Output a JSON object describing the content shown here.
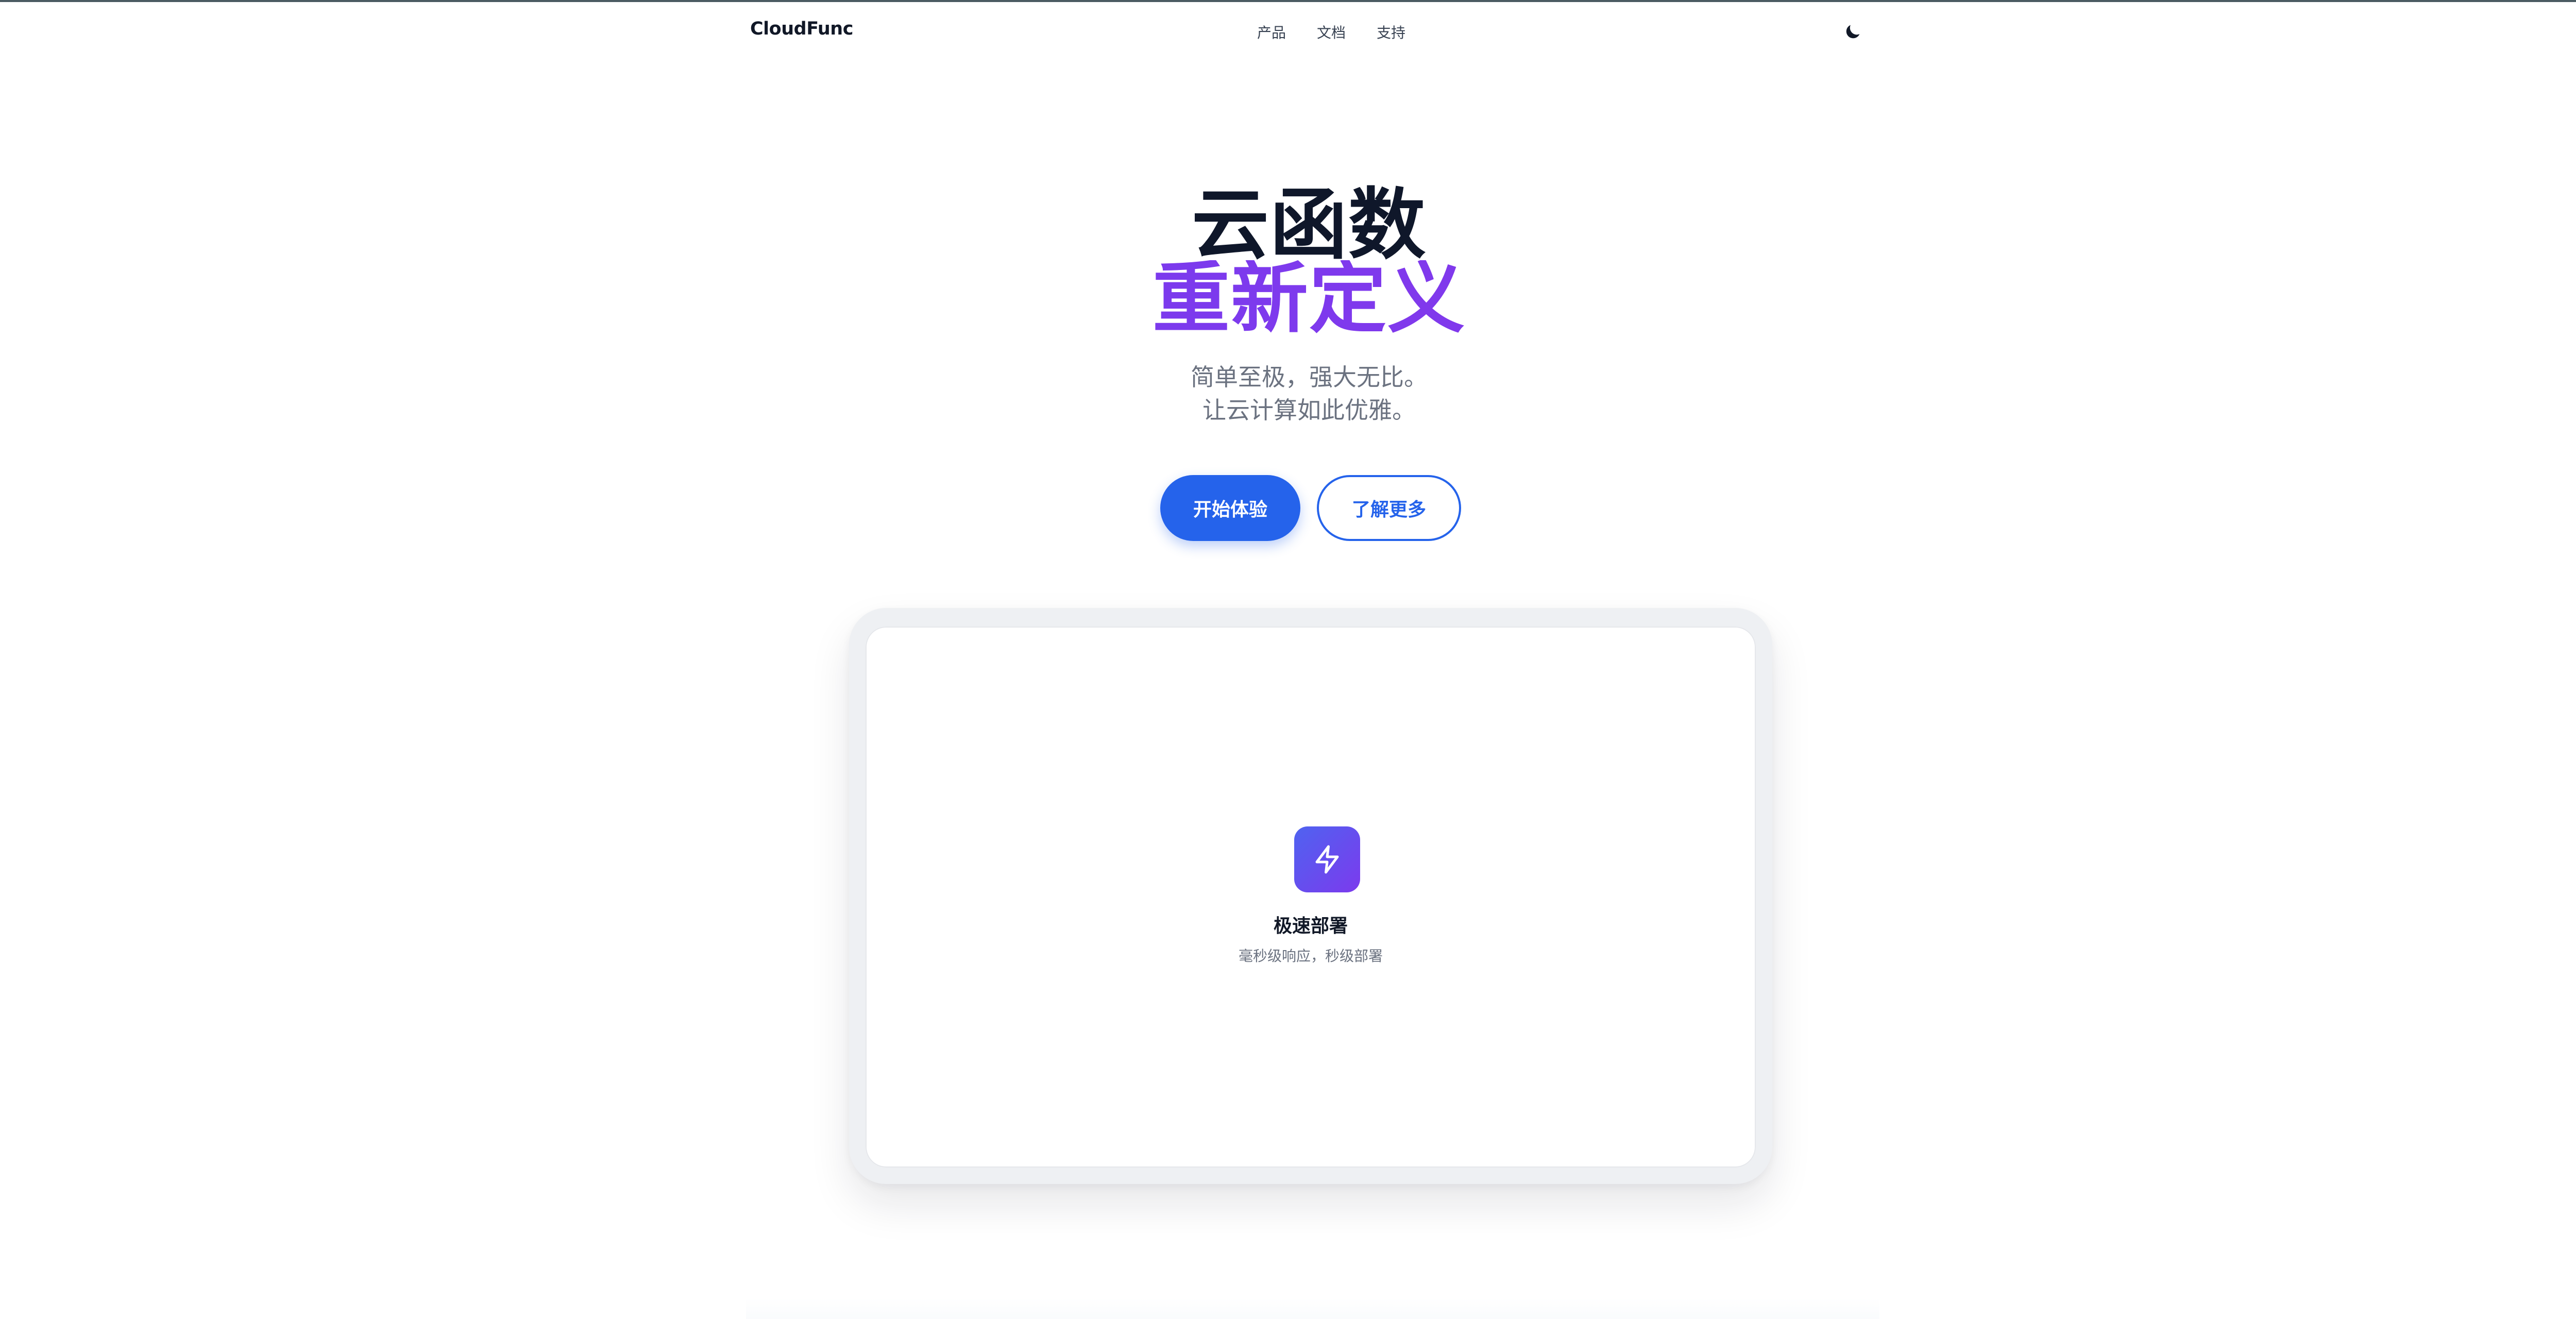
{
  "header": {
    "brand": "CloudFunc",
    "nav": [
      {
        "label": "产品"
      },
      {
        "label": "文档"
      },
      {
        "label": "支持"
      }
    ],
    "theme_toggle_icon": "moon-icon"
  },
  "hero": {
    "title_line1": "云函数",
    "title_line2": "重新定义",
    "subtitle_line1": "简单至极，强大无比。",
    "subtitle_line2": "让云计算如此优雅。",
    "primary_button": "开始体验",
    "secondary_button": "了解更多"
  },
  "showcase": {
    "feature": {
      "icon": "lightning-icon",
      "title": "极速部署",
      "description": "毫秒级响应，秒级部署"
    }
  },
  "colors": {
    "primary": "#2563eb",
    "accent_purple": "#7c3aed",
    "title_dark": "#0f172a",
    "muted_text": "#6b7280"
  }
}
